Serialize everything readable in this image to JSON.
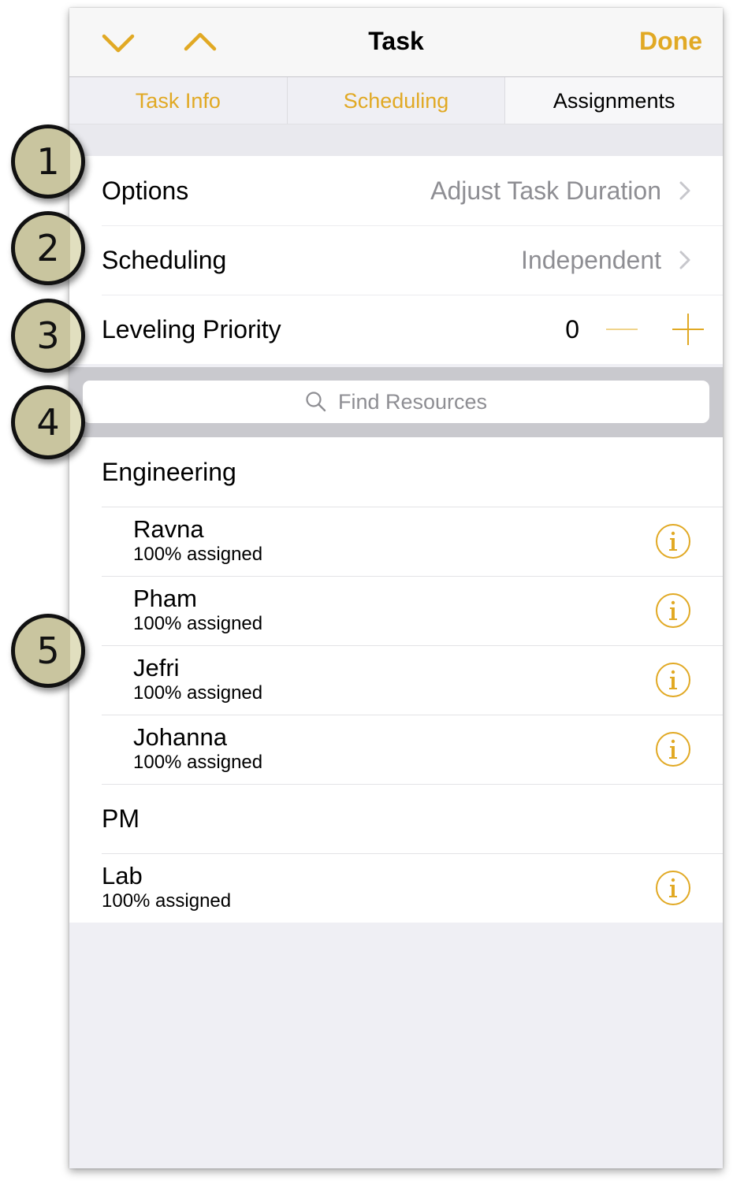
{
  "navbar": {
    "title": "Task",
    "done_label": "Done",
    "prev_icon": "chevron-down-icon",
    "next_icon": "chevron-up-icon"
  },
  "tabs": [
    {
      "label": "Task Info",
      "active": false
    },
    {
      "label": "Scheduling",
      "active": false
    },
    {
      "label": "Assignments",
      "active": true
    }
  ],
  "settings": {
    "options": {
      "label": "Options",
      "value": "Adjust Task Duration"
    },
    "scheduling": {
      "label": "Scheduling",
      "value": "Independent"
    },
    "leveling": {
      "label": "Leveling Priority",
      "value": "0"
    }
  },
  "search": {
    "placeholder": "Find Resources"
  },
  "resources": {
    "groups": [
      {
        "name": "Engineering",
        "members": [
          {
            "name": "Ravna",
            "status": "100% assigned"
          },
          {
            "name": "Pham",
            "status": "100% assigned"
          },
          {
            "name": "Jefri",
            "status": "100% assigned"
          },
          {
            "name": "Johanna",
            "status": "100% assigned"
          }
        ]
      },
      {
        "name": "PM",
        "members": []
      }
    ],
    "ungrouped": [
      {
        "name": "Lab",
        "status": "100% assigned"
      }
    ]
  },
  "callouts": [
    "1",
    "2",
    "3",
    "4",
    "5"
  ],
  "colors": {
    "accent": "#e1a924",
    "secondary_text": "#8e8e93",
    "background": "#efeff4",
    "callout_fill": "#c9c59f"
  }
}
